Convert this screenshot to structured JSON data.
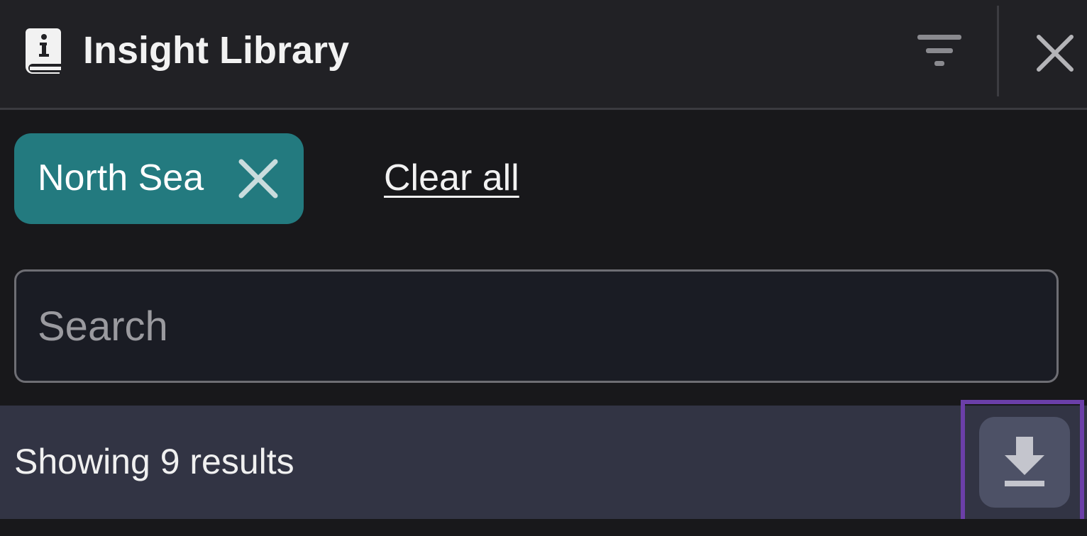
{
  "header": {
    "title": "Insight Library",
    "icon": "book-info-icon",
    "filter_icon": "filter-icon",
    "close_icon": "close-icon"
  },
  "filters": {
    "chips": [
      {
        "label": "North Sea",
        "remove_icon": "close-icon"
      }
    ],
    "clear_all_label": "Clear all"
  },
  "search": {
    "placeholder": "Search",
    "value": ""
  },
  "results": {
    "summary": "Showing 9 results",
    "download_icon": "download-icon"
  },
  "colors": {
    "header_bg": "#212125",
    "panel_bg": "#18181b",
    "chip_bg": "#237a7f",
    "results_bar_bg": "#323444",
    "download_button_bg": "#4d5166",
    "highlight_outline": "#6b3fa8"
  }
}
